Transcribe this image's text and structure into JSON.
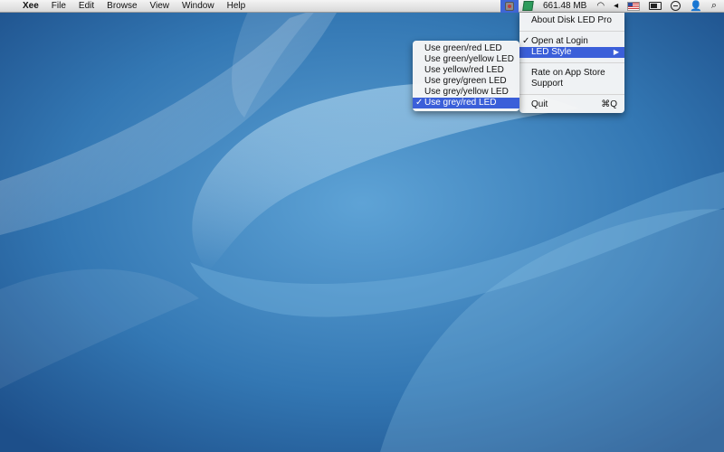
{
  "menubar": {
    "apple_glyph": "",
    "items": [
      "Xee",
      "File",
      "Edit",
      "Browse",
      "View",
      "Window",
      "Help"
    ],
    "memory_text": "661.48 MB",
    "wifi_glyph": "◠",
    "volume_glyph": "◂",
    "user_glyph": "👤",
    "search_glyph": "⌕"
  },
  "main_menu": {
    "about": "About Disk LED Pro",
    "open_at_login": "Open at Login",
    "led_style": "LED Style",
    "rate": "Rate on App Store",
    "support": "Support",
    "quit": "Quit",
    "quit_shortcut": "⌘Q",
    "check_glyph": "✓",
    "arrow_glyph": "▶"
  },
  "led_submenu": {
    "items": [
      "Use green/red LED",
      "Use green/yellow LED",
      "Use yellow/red LED",
      "Use grey/green LED",
      "Use grey/yellow LED",
      "Use grey/red LED"
    ],
    "check_glyph": "✓"
  },
  "colors": {
    "selection": "#3b5fd9",
    "wallpaper_base": "#2f6fa8",
    "wallpaper_light": "#8fc5e6"
  },
  "icons": [
    "apple-icon",
    "disk-led-icon",
    "green-doc-icon",
    "wifi-icon",
    "volume-icon",
    "flag-icon",
    "battery-icon",
    "clock-icon",
    "user-icon",
    "spotlight-icon"
  ]
}
